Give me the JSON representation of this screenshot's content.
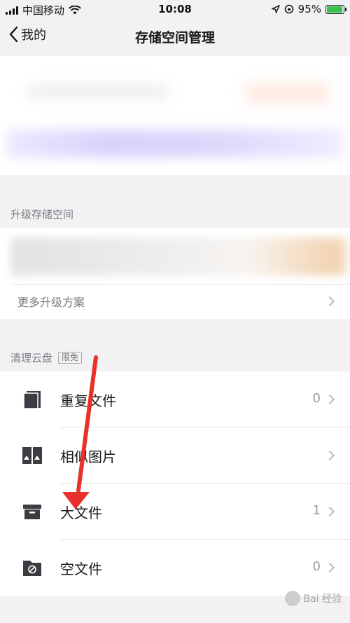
{
  "status": {
    "carrier": "中国移动",
    "time": "10:08",
    "battery": "95%",
    "battery_level": 0.95
  },
  "nav": {
    "back_label": "我的",
    "title": "存储空间管理"
  },
  "upgrade": {
    "section_label": "升级存储空间",
    "more_label": "更多升级方案"
  },
  "clean": {
    "section_label": "清理云盘",
    "tag": "限免",
    "items": [
      {
        "label": "重复文件",
        "count": "0",
        "icon": "duplicate-files-icon"
      },
      {
        "label": "相似图片",
        "count": "",
        "icon": "similar-images-icon"
      },
      {
        "label": "大文件",
        "count": "1",
        "icon": "archive-box-icon"
      },
      {
        "label": "空文件",
        "count": "0",
        "icon": "empty-folder-icon"
      }
    ]
  },
  "watermark": {
    "text": "Bai 经验"
  },
  "colors": {
    "annotation_arrow": "#e8312a",
    "battery_green": "#38c14a"
  }
}
